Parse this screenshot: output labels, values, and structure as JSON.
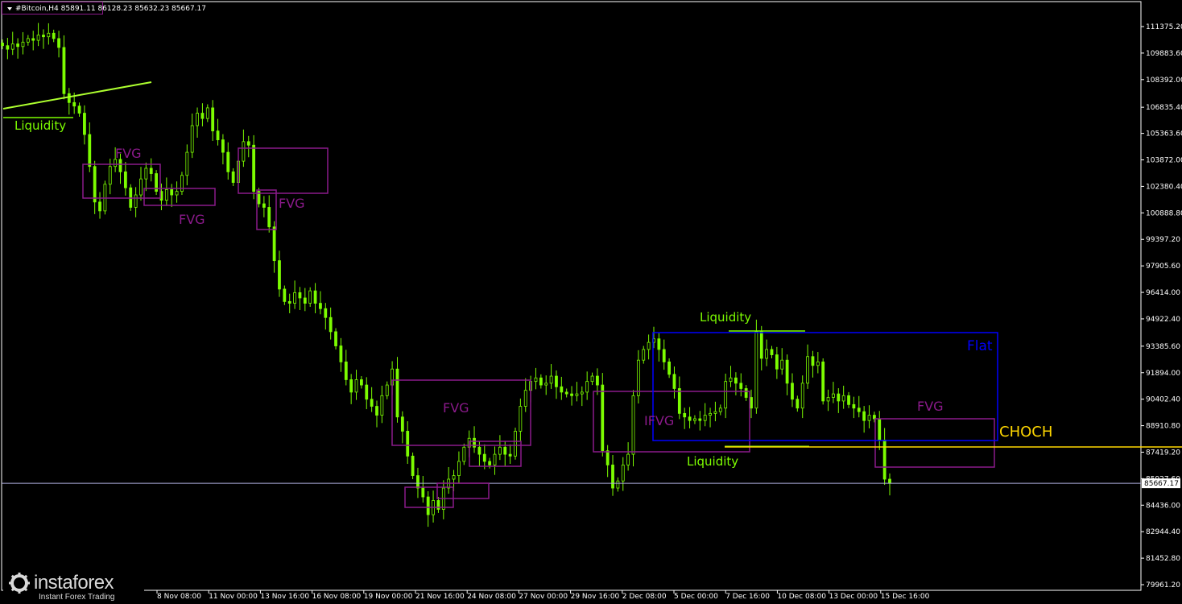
{
  "header": {
    "symbol": "#Bitcoin,H4",
    "ohlc": "85891.11 86128.23 85632.23 85667.17"
  },
  "colors": {
    "background": "#000000",
    "candle": "#7cfc00",
    "fvg": "#8b1a8b",
    "fvg_text": "#8b1a8b",
    "liquidity": "#7cfc00",
    "flat": "#0000ff",
    "choch": "#ffd700",
    "trendline": "#adff2f",
    "price_line": "#b0b0e0",
    "axis": "#ffffff"
  },
  "chart_data": {
    "type": "candlestick",
    "title": "",
    "y_ticks": [
      "111375.20",
      "109883.60",
      "108392.00",
      "106835.40",
      "105363.60",
      "103872.00",
      "102380.40",
      "100888.80",
      "99397.20",
      "97905.60",
      "96414.00",
      "94922.40",
      "93385.60",
      "91894.00",
      "90402.40",
      "88910.80",
      "87419.20",
      "85927.60",
      "84436.00",
      "82944.40",
      "81452.80",
      "79961.20"
    ],
    "ylim": [
      79961.2,
      111375.2
    ],
    "x_ticks": [
      "",
      "8 Nov 08:00",
      "11 Nov 00:00",
      "13 Nov 16:00",
      "16 Nov 08:00",
      "19 Nov 00:00",
      "21 Nov 16:00",
      "24 Nov 08:00",
      "27 Nov 00:00",
      "29 Nov 16:00",
      "2 Dec 08:00",
      "5 Dec 00:00",
      "7 Dec 16:00",
      "10 Dec 08:00",
      "13 Dec 00:00",
      "15 Dec 16:00"
    ],
    "current_price": "85667.17",
    "close_series": [
      110300,
      110100,
      110400,
      110250,
      110500,
      110700,
      110600,
      110900,
      110800,
      111000,
      110700,
      110200,
      107600,
      107100,
      106900,
      106500,
      105300,
      103500,
      101500,
      101000,
      102500,
      103500,
      103900,
      103200,
      102300,
      101200,
      101900,
      102800,
      103400,
      103100,
      102100,
      101600,
      102200,
      101900,
      102100,
      103000,
      104300,
      105800,
      106500,
      106200,
      106800,
      105500,
      105000,
      104300,
      103200,
      102600,
      103800,
      104900,
      104700,
      102100,
      101400,
      101200,
      100100,
      98200,
      96600,
      95900,
      95800,
      96400,
      96100,
      95800,
      96500,
      95800,
      95500,
      95000,
      94200,
      93400,
      92500,
      91500,
      90800,
      91500,
      91200,
      90400,
      90000,
      89500,
      90600,
      91200,
      92100,
      89400,
      88600,
      87200,
      86100,
      85400,
      84900,
      83900,
      84700,
      84200,
      85400,
      85900,
      86100,
      86900,
      87700,
      88200,
      87700,
      87300,
      86900,
      86700,
      87300,
      87700,
      87300,
      87200,
      88600,
      90000,
      90900,
      91400,
      91600,
      91200,
      91300,
      91700,
      91100,
      90800,
      90700,
      90600,
      90700,
      90800,
      91400,
      91700,
      91200,
      87500,
      86700,
      85400,
      85800,
      86700,
      87300,
      90600,
      92600,
      93200,
      93600,
      93800,
      93200,
      92500,
      91800,
      91000,
      89600,
      89400,
      89200,
      89300,
      89200,
      89500,
      89600,
      89700,
      89900,
      91400,
      91600,
      91300,
      91000,
      90500,
      89900,
      94200,
      92700,
      93200,
      92900,
      92100,
      92600,
      91300,
      90400,
      89900,
      91300,
      92800,
      92300,
      92500,
      90300,
      90500,
      90700,
      90300,
      90600,
      90100,
      89900,
      89700,
      89200,
      89500,
      89300,
      88100,
      85900,
      85667
    ],
    "liquidity_labels": [
      "Liquidity",
      "Liquidity",
      "Liquidity"
    ],
    "fvg_labels": [
      "FVG",
      "FVG",
      "FVG",
      "FVG",
      "FVG",
      "IFVG"
    ],
    "flat_label": "Flat",
    "choch_label": "CHOCH"
  },
  "watermark": {
    "brand": "instaforex",
    "tagline": "Instant Forex Trading"
  }
}
